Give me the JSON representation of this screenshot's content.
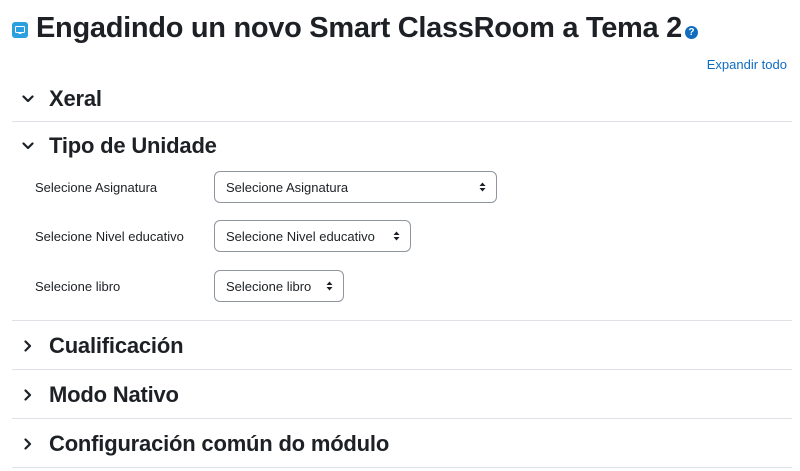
{
  "page": {
    "title": "Engadindo un novo Smart ClassRoom a Tema 2",
    "module_icon": "smart-classroom-icon",
    "help_icon": "help-icon",
    "help_glyph": "?"
  },
  "toolbar": {
    "expand_all_label": "Expandir todo"
  },
  "sections": {
    "general": {
      "label": "Xeral",
      "state": "expanded"
    },
    "unit_type": {
      "label": "Tipo de Unidade",
      "state": "expanded",
      "fields": {
        "subject": {
          "label": "Selecione Asignatura",
          "value": "Selecione Asignatura"
        },
        "level": {
          "label": "Selecione Nivel educativo",
          "value": "Selecione Nivel educativo"
        },
        "book": {
          "label": "Selecione libro",
          "value": "Selecione libro"
        }
      }
    },
    "grade": {
      "label": "Cualificación",
      "state": "collapsed"
    },
    "native_mode": {
      "label": "Modo Nativo",
      "state": "collapsed"
    },
    "common_settings": {
      "label": "Configuración común do módulo",
      "state": "collapsed"
    }
  },
  "colors": {
    "link": "#0f6cbf",
    "module_icon_bg": "#2b9fe0",
    "divider": "#dee2e6",
    "text": "#1d2125"
  }
}
